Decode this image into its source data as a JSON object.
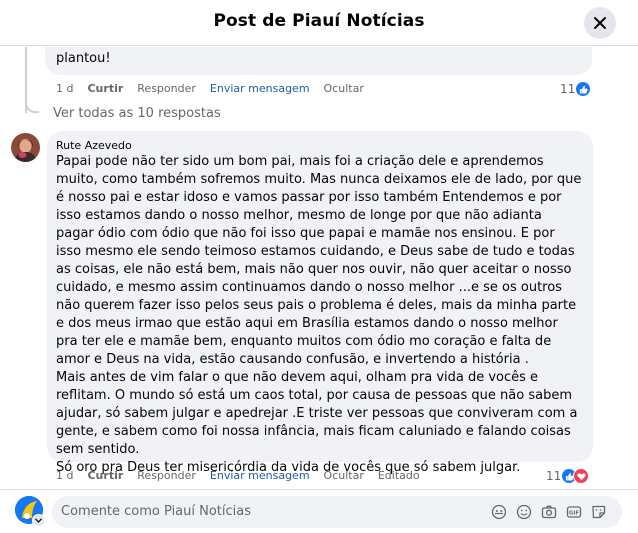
{
  "dialog": {
    "title": "Post de Piauí Notícias"
  },
  "previous_reply": {
    "text_tail": "plantou!",
    "time": "1 d",
    "like": "Curtir",
    "reply": "Responder",
    "message": "Enviar mensagem",
    "hide": "Ocultar",
    "reaction_count": "11"
  },
  "see_all": "Ver todas as 10 respostas",
  "comment": {
    "author": "Rute Azevedo",
    "text": "Papai pode não ter sido um bom pai, mais foi a criação dele e aprendemos muito, como também sofremos muito. Mas nunca deixamos ele de lado, por que é nosso pai e estar idoso e vamos passar por isso também Entendemos e por isso estamos dando o nosso melhor, mesmo de longe por que não adianta pagar ódio com ódio que não foi isso que papai e mamãe nos ensinou. E por isso mesmo ele sendo teimoso estamos cuidando, e Deus sabe de tudo e todas as coisas, ele não está bem, mais não quer nos ouvir, não quer aceitar o nosso cuidado, e mesmo assim continuamos dando o nosso melhor ...e se os outros não querem fazer isso pelos seus pais o problema é deles, mais da minha parte e dos meus irmao que estão aqui em Brasília estamos dando o nosso melhor pra ter ele e mamãe bem, enquanto muitos com ódio mo coração e falta de amor e Deus na vida, estão causando confusão, e invertendo a história .\nMais antes de vim falar o que não devem aqui, olham pra vida de vocês e reflitam. O mundo só está um caos total, por causa de pessoas que não sabem ajudar, só sabem julgar e apedrejar .E triste ver pessoas que conviveram com a gente, e sabem como foi nossa infância, mais ficam caluniado e falando coisas sem sentido.\nSó oro pra Deus ter misericórdia da vida de vocês que só sabem julgar.",
    "time": "1 d",
    "like": "Curtir",
    "reply": "Responder",
    "message": "Enviar mensagem",
    "hide": "Ocultar",
    "edited": "Editado",
    "reaction_count": "11"
  },
  "composer": {
    "placeholder": "Comente como Piauí Notícias"
  },
  "icons": [
    "close-icon",
    "like-icon",
    "love-icon",
    "avatar-switch-chevron-icon",
    "avatar-icon",
    "emoji-icon",
    "camera-icon",
    "gif-icon",
    "sticker-icon"
  ],
  "colors": {
    "like": "#1877f2",
    "love": "#f33e58",
    "link": "#1e5aa8",
    "bubble": "#f0f2f5"
  }
}
